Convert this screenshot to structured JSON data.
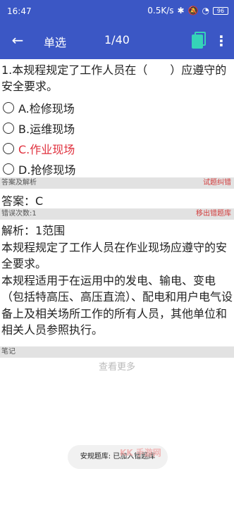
{
  "statusbar": {
    "time": "16:47",
    "speed": "0.5K/s",
    "battery": "96"
  },
  "appbar": {
    "title": "单选",
    "counter": "1/40"
  },
  "question": {
    "text": "1.本规程规定了工作人员在（　　）应遵守的安全要求。"
  },
  "options": [
    {
      "label": "A.检修现场",
      "correct": false
    },
    {
      "label": "B.运维现场",
      "correct": false
    },
    {
      "label": "C.作业现场",
      "correct": true
    },
    {
      "label": "D.抢修现场",
      "correct": false
    }
  ],
  "section_answer": {
    "title": "答案及解析",
    "action": "试题纠错"
  },
  "answer": {
    "text": "答案：C"
  },
  "section_errors": {
    "title": "错误次数:1",
    "action": "移出错题库"
  },
  "analysis": {
    "p1": "解析：1范围",
    "p2": "本规程规定了工作人员在作业现场应遵守的安全要求。",
    "p3": "本规程适用于在运用中的发电、输电、变电（包括特高压、高压直流）、配电和用户电气设备上及相关场所工作的所有人员，其他单位和相关人员参照执行。"
  },
  "section_notes": {
    "title": "笔记"
  },
  "more_link": "查看更多",
  "toast": "安规题库: 已加入错题库",
  "watermark": "KK 手游网",
  "colors": {
    "primary": "#3b57c5",
    "accent_red": "#e0303d",
    "icon_teal": "#35d4b8"
  }
}
